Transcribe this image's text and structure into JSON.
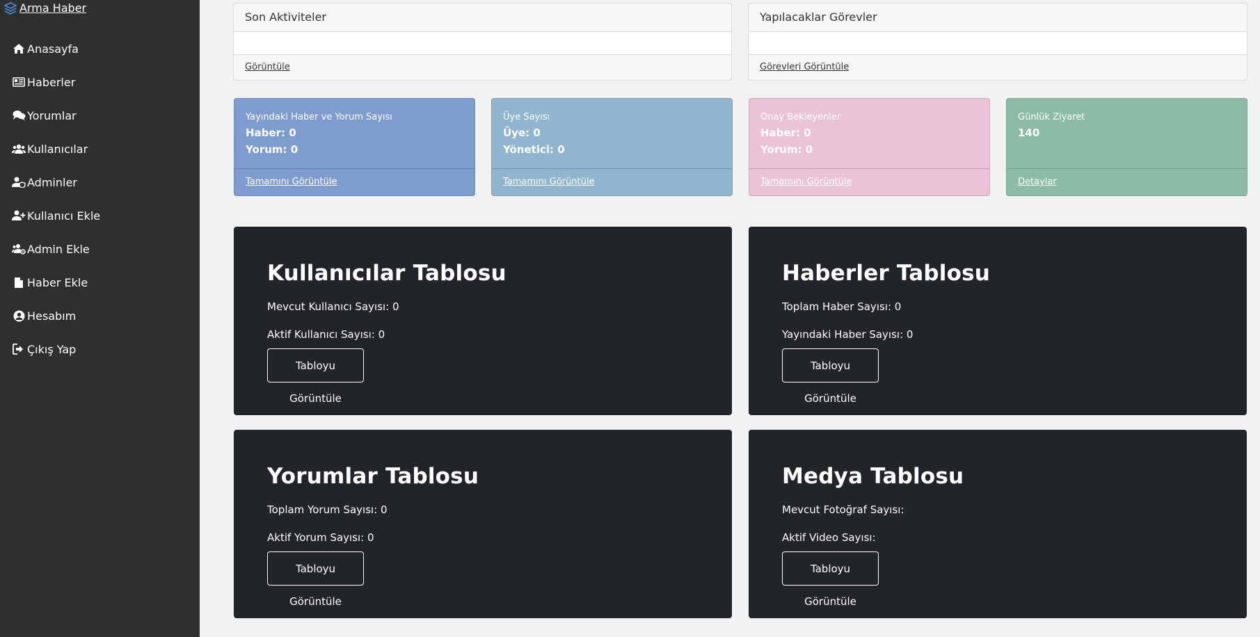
{
  "brand": {
    "label": "Arma Haber",
    "icon": "layers-icon"
  },
  "nav": [
    {
      "label": "Anasayfa",
      "icon": "home-icon"
    },
    {
      "label": "Haberler",
      "icon": "newspaper-icon"
    },
    {
      "label": "Yorumlar",
      "icon": "comments-icon"
    },
    {
      "label": "Kullanıcılar",
      "icon": "users-icon"
    },
    {
      "label": "Adminler",
      "icon": "user-shield-icon"
    },
    {
      "label": "Kullanıcı Ekle",
      "icon": "user-plus-icon"
    },
    {
      "label": "Admin Ekle",
      "icon": "users-cog-icon"
    },
    {
      "label": "Haber Ekle",
      "icon": "file-icon"
    },
    {
      "label": "Hesabım",
      "icon": "user-circle-icon"
    },
    {
      "label": "Çıkış Yap",
      "icon": "sign-out-icon"
    }
  ],
  "top_cards": [
    {
      "title": "Son Aktiviteler",
      "link": "Görüntüle"
    },
    {
      "title": "Yapılacaklar Görevler",
      "link": "Görevleri Görüntüle"
    }
  ],
  "stats": [
    {
      "title": "Yayındaki Haber ve Yorum Sayısı",
      "line1": "Haber: 0",
      "line2": "Yorum: 0",
      "link": "Tamamını Görüntüle",
      "color": "#7f9ccf"
    },
    {
      "title": "Üye Sayısı",
      "line1": "Üye: 0",
      "line2": "Yönetici: 0",
      "link": "Tamamını Görüntüle",
      "color": "#91b5ce"
    },
    {
      "title": "Onay Bekleyenler",
      "line1": "Haber: 0",
      "line2": "Yorum: 0",
      "link": "Tamamını Görüntüle",
      "color": "#eac3d6"
    },
    {
      "title": "Günlük Ziyaret",
      "line1": "140",
      "line2": "",
      "link": "Detaylar",
      "color": "#8cbca5"
    }
  ],
  "panels": [
    {
      "title": "Kullanıcılar Tablosu",
      "line1": "Mevcut Kullanıcı Sayısı: 0",
      "line2": "Aktif Kullanıcı Sayısı: 0",
      "button": "Tabloyu Görüntüle"
    },
    {
      "title": "Haberler Tablosu",
      "line1": "Toplam Haber Sayısı: 0",
      "line2": "Yayındaki Haber Sayısı: 0",
      "button": "Tabloyu Görüntüle"
    },
    {
      "title": "Yorumlar Tablosu",
      "line1": "Toplam Yorum Sayısı: 0",
      "line2": "Aktif Yorum Sayısı: 0",
      "button": "Tabloyu Görüntüle"
    },
    {
      "title": "Medya Tablosu",
      "line1": "Mevcut Fotoğraf Sayısı:",
      "line2": "Aktif Video Sayısı:",
      "button": "Tabloyu Görüntüle"
    }
  ]
}
